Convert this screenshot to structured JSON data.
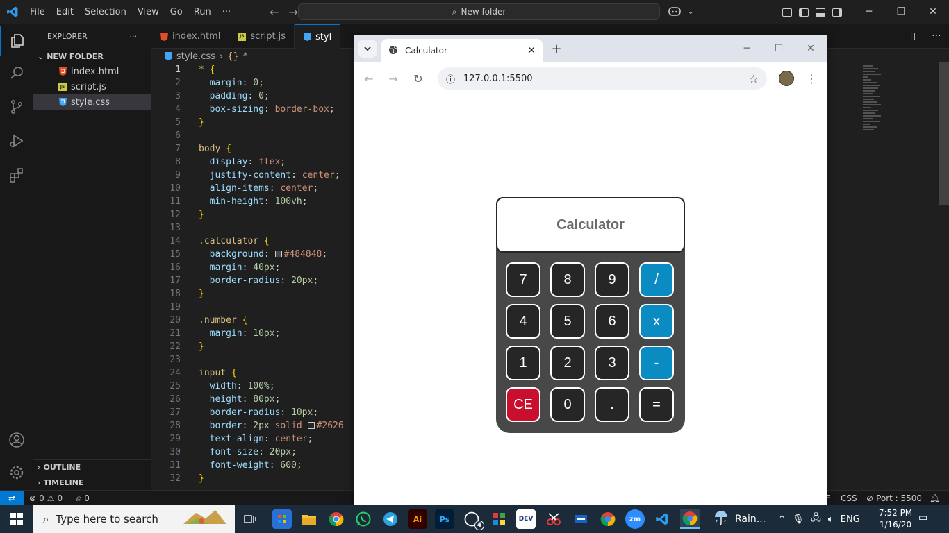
{
  "vscode": {
    "menu": [
      "File",
      "Edit",
      "Selection",
      "View",
      "Go",
      "Run",
      "···"
    ],
    "command_center": "New folder",
    "explorer_title": "EXPLORER",
    "explorer_more": "···",
    "folder": "NEW FOLDER",
    "files": [
      {
        "name": "index.html",
        "icon": "5",
        "color": "#e44d26"
      },
      {
        "name": "script.js",
        "icon": "JS",
        "color": "#cbcb41"
      },
      {
        "name": "style.css",
        "icon": "3",
        "color": "#42a5f5"
      }
    ],
    "outline": "OUTLINE",
    "timeline": "TIMELINE",
    "tabs": [
      {
        "name": "index.html",
        "icon": "5",
        "color": "#e44d26"
      },
      {
        "name": "script.js",
        "icon": "JS",
        "color": "#cbcb41"
      },
      {
        "name": "styl",
        "icon": "3",
        "color": "#42a5f5"
      }
    ],
    "breadcrumb": {
      "file": "style.css",
      "separator": "›",
      "symbol": "*"
    },
    "status": {
      "errors": "0",
      "warnings": "0",
      "ports": "0",
      "language_fragment": "F",
      "language": "CSS",
      "port": "Port : 5500"
    }
  },
  "browser": {
    "tab_title": "Calculator",
    "url": "127.0.0.1:5500"
  },
  "calculator": {
    "display": "Calculator",
    "keys": [
      "7",
      "8",
      "9",
      "/",
      "4",
      "5",
      "6",
      "x",
      "1",
      "2",
      "3",
      "-",
      "CE",
      "0",
      ".",
      "="
    ]
  },
  "taskbar": {
    "search_placeholder": "Type here to search",
    "weather": "Rain...",
    "language": "ENG",
    "time": "7:52 PM",
    "date": "1/16/20",
    "whatsapp_badge": "4",
    "apps": [
      "Ai",
      "Ps",
      "DEV",
      "zm"
    ]
  },
  "colors": {
    "accent": "#0078d4",
    "calc_bg": "#484848",
    "key_dark": "#262626",
    "key_op": "#0a8cc3",
    "key_clear": "#c8102e"
  }
}
